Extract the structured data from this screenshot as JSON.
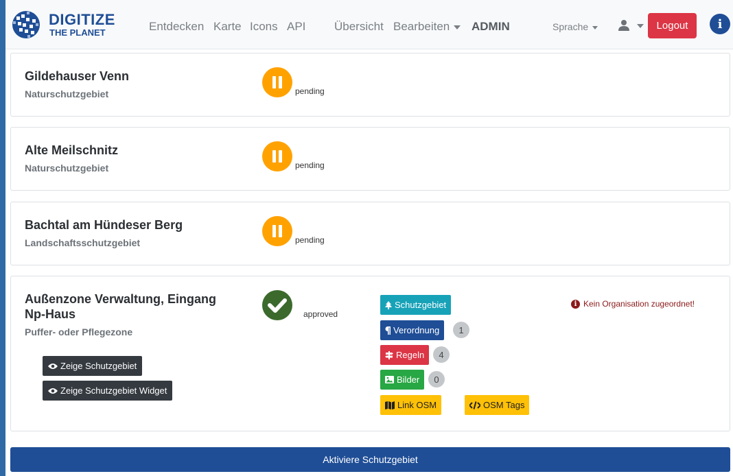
{
  "brand": {
    "title": "DIGITIZE",
    "subtitle": "THE PLANET",
    "color": "#1f4e96"
  },
  "nav": {
    "links": [
      "Entdecken",
      "Karte",
      "Icons",
      "API",
      "Übersicht",
      "Bearbeiten",
      "ADMIN"
    ],
    "language": "Sprache",
    "logout": "Logout"
  },
  "areas": [
    {
      "name": "Gildehauser Venn",
      "type": "Naturschutzgebiet",
      "status": "pending"
    },
    {
      "name": "Alte Meilschnitz",
      "type": "Naturschutzgebiet",
      "status": "pending"
    },
    {
      "name": "Bachtal am Hündeser Berg",
      "type": "Landschaftsschutzgebiet",
      "status": "pending"
    }
  ],
  "detail": {
    "name_line1": "Außenzone Verwaltung, Eingang",
    "name_line2": "Np-Haus",
    "type": "Puffer- oder Pflegezone",
    "status": "approved",
    "buttons": {
      "show_area": "Zeige Schutzgebiet",
      "show_widget": "Zeige Schutzgebiet Widget"
    },
    "tags": {
      "schutzgebiet": "Schutzgebiet",
      "verordnung": "Verordnung",
      "verordnung_count": "1",
      "regeln": "Regeln",
      "regeln_count": "4",
      "bilder": "Bilder",
      "bilder_count": "0",
      "link_osm": "Link OSM",
      "osm_tags": "OSM Tags"
    },
    "warning": "Kein Organisation zugeordnet!"
  },
  "activate": "Aktiviere Schutzgebiet",
  "colors": {
    "pending": "#ffa200",
    "approved": "#3b6a2c",
    "danger": "#dc3545",
    "info": "#17a2b8",
    "success": "#28a745",
    "warning": "#ffc107"
  }
}
